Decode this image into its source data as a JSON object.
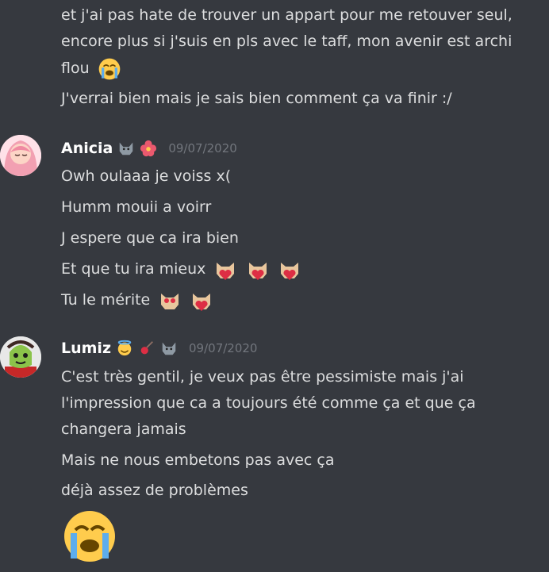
{
  "top_message": {
    "lines": [
      "et j'ai pas hate de trouver un appart pour me retouver seul,",
      "encore plus si j'suis en pls avec le taff, mon avenir est archi",
      "flou",
      "J'verrai bien mais je sais bien comment ça va finir :/"
    ],
    "emoji": "loudly-crying-face"
  },
  "anicia": {
    "username": "Anicia",
    "badges": [
      "wolf-emoji",
      "hibiscus-emoji"
    ],
    "timestamp": "09/07/2020",
    "lines": [
      "Owh oulaaa je voiss x(",
      "Humm mouii a voirr",
      "J espere que ca ira bien",
      "Et que tu ira mieux",
      "Tu le mérite"
    ]
  },
  "lumiz": {
    "username": "Lumiz",
    "badges": [
      "smiling-halo-emoji",
      "guitar-emoji",
      "wolf-emoji"
    ],
    "timestamp": "09/07/2020",
    "lines": [
      "C'est très gentil, je veux pas être pessimiste mais j'ai",
      "l'impression que ca a toujours été comme ça et que ça",
      "changera jamais",
      "Mais ne nous embetons pas avec ça",
      "déjà assez de problèmes"
    ],
    "big_emoji": "loudly-crying-face"
  }
}
